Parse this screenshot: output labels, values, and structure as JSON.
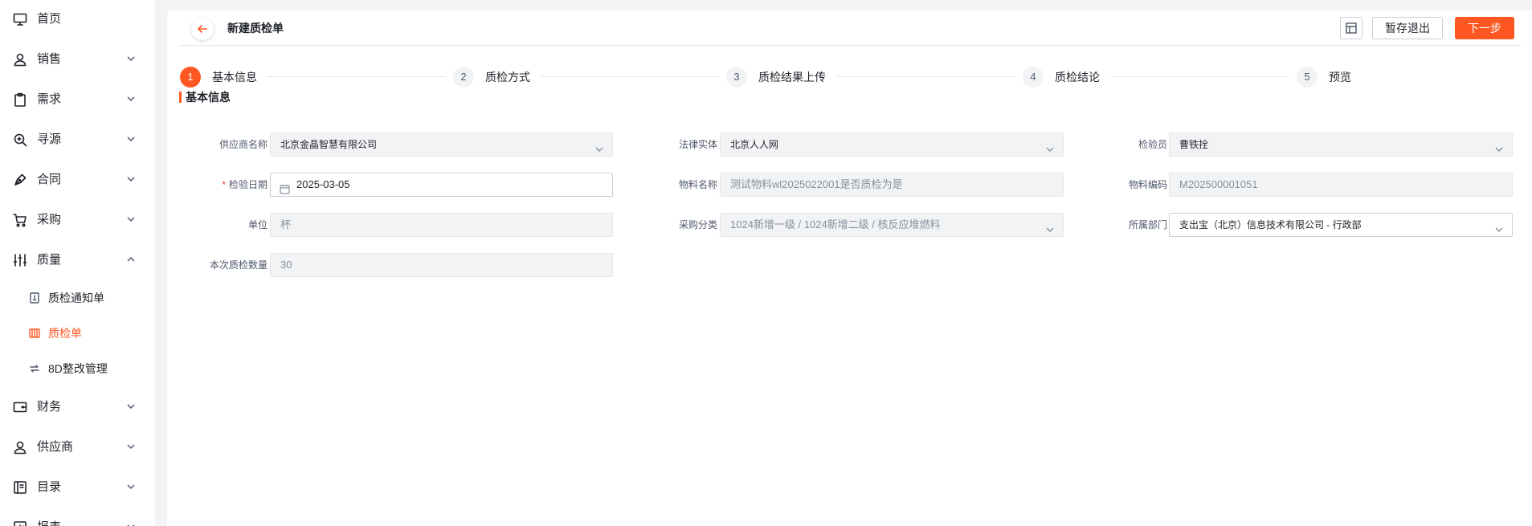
{
  "sidebar": {
    "items": [
      {
        "label": "首页",
        "icon": "monitor-icon"
      },
      {
        "label": "销售",
        "icon": "user-icon"
      },
      {
        "label": "需求",
        "icon": "clipboard-icon"
      },
      {
        "label": "寻源",
        "icon": "search-icon"
      },
      {
        "label": "合同",
        "icon": "pen-icon"
      },
      {
        "label": "采购",
        "icon": "cart-icon"
      },
      {
        "label": "质量",
        "icon": "sliders-icon"
      },
      {
        "label": "财务",
        "icon": "wallet-icon"
      },
      {
        "label": "供应商",
        "icon": "supplier-icon"
      },
      {
        "label": "目录",
        "icon": "book-icon"
      },
      {
        "label": "报表",
        "icon": "report-icon"
      }
    ],
    "quality_sub": [
      {
        "label": "质检通知单",
        "icon": "notice-icon"
      },
      {
        "label": "质检单",
        "icon": "inspection-icon"
      },
      {
        "label": "8D整改管理",
        "icon": "rectify-icon"
      }
    ]
  },
  "header": {
    "title": "新建质检单",
    "save_exit_label": "暂存退出",
    "next_label": "下一步"
  },
  "steps": [
    {
      "num": "1",
      "label": "基本信息"
    },
    {
      "num": "2",
      "label": "质检方式"
    },
    {
      "num": "3",
      "label": "质检结果上传"
    },
    {
      "num": "4",
      "label": "质检结论"
    },
    {
      "num": "5",
      "label": "预览"
    }
  ],
  "section_title": "基本信息",
  "form": {
    "supplier_label": "供应商名称",
    "supplier_value": "北京金晶智慧有限公司",
    "legal_label": "法律实体",
    "legal_value": "北京人人网",
    "inspector_label": "检验员",
    "inspector_value": "曹铁拴",
    "date_required": "*",
    "date_label": "检验日期",
    "date_value": "2025-03-05",
    "material_name_label": "物料名称",
    "material_name_value": "测试物料wl2025022001是否质检为是",
    "material_code_label": "物料编码",
    "material_code_value": "M202500001051",
    "unit_label": "单位",
    "unit_value": "杯",
    "category_label": "采购分类",
    "category_value": "1024新增一级 / 1024新增二级 / 核反应堆燃料",
    "dept_label": "所属部门",
    "dept_value": "支出宝（北京）信息技术有限公司 - 行政部",
    "qty_label": "本次质检数量",
    "qty_value": "30"
  },
  "colors": {
    "accent": "#ff5722",
    "sidebar_bg": "#ffffff",
    "page_bg": "#f2f3f5"
  }
}
